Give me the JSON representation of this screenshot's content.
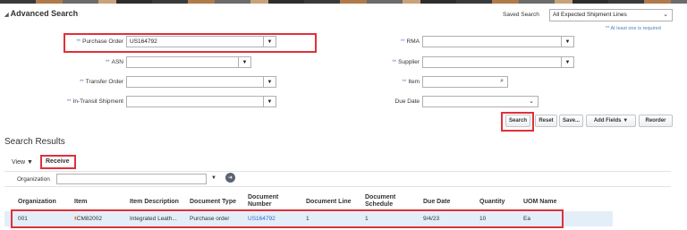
{
  "header": {
    "title": "Advanced Search",
    "saved_search_label": "Saved Search",
    "saved_search_value": "All Expected Shipment Lines",
    "required_note": "** At least one is required"
  },
  "form": {
    "purchase_order": {
      "label": "Purchase Order",
      "value": "US164792"
    },
    "asn": {
      "label": "ASN",
      "value": ""
    },
    "transfer_order": {
      "label": "Transfer Order",
      "value": ""
    },
    "in_transit_shipment": {
      "label": "In-Transit Shipment",
      "value": ""
    },
    "rma": {
      "label": "RMA",
      "value": ""
    },
    "supplier": {
      "label": "Supplier",
      "value": ""
    },
    "item": {
      "label": "Item",
      "value": ""
    },
    "due_date": {
      "label": "Due Date",
      "value": ""
    },
    "required_marker": "**"
  },
  "actions": {
    "search": "Search",
    "reset": "Reset",
    "save": "Save...",
    "add_fields": "Add Fields",
    "reorder": "Reorder"
  },
  "results": {
    "title": "Search Results",
    "view_label": "View",
    "receive_label": "Receive",
    "organization_label": "Organization",
    "organization_value": "",
    "columns": [
      "Organization",
      "Item",
      "Item Description",
      "Document Type",
      "Document Number",
      "Document Line",
      "Document Schedule",
      "Due Date",
      "Quantity",
      "UOM Name"
    ],
    "rows": [
      {
        "organization": "001",
        "item": "CM82002",
        "item_description": "Integrated Leath...",
        "document_type": "Purchase order",
        "document_number": "US164792",
        "document_line": "1",
        "document_schedule": "1",
        "due_date": "9/4/23",
        "quantity": "10",
        "uom_name": "Ea"
      }
    ]
  },
  "colors": {
    "highlight_red": "#e0303a",
    "link_blue": "#2a6ec8",
    "row_selected": "#e4eef8"
  },
  "icons": [
    "dropdown-arrow-icon",
    "search-icon",
    "chevron-down-icon",
    "collapse-triangle-icon",
    "go-arrow-icon"
  ]
}
